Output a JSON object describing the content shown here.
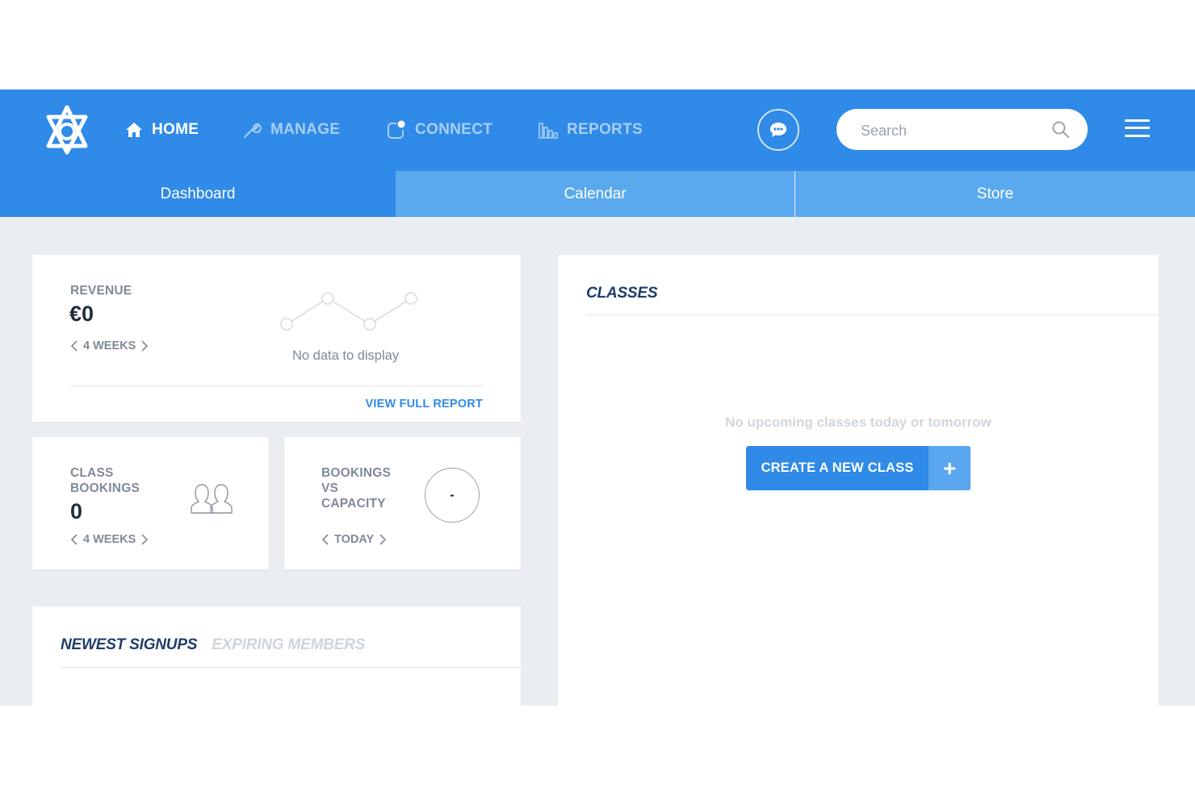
{
  "header": {
    "nav": [
      {
        "label": "HOME",
        "icon": "home-icon"
      },
      {
        "label": "MANAGE",
        "icon": "wrench-icon"
      },
      {
        "label": "CONNECT",
        "icon": "connect-icon"
      },
      {
        "label": "REPORTS",
        "icon": "bar-chart-icon"
      }
    ],
    "search_placeholder": "Search"
  },
  "subtabs": [
    {
      "label": "Dashboard",
      "active": true
    },
    {
      "label": "Calendar",
      "active": false
    },
    {
      "label": "Store",
      "active": false
    }
  ],
  "revenue": {
    "label": "REVENUE",
    "value": "€0",
    "period": "4 WEEKS",
    "empty_text": "No data to display",
    "link": "VIEW FULL REPORT"
  },
  "class_bookings": {
    "label_line1": "CLASS",
    "label_line2": "BOOKINGS",
    "value": "0",
    "period": "4 WEEKS",
    "icon": "people-icon"
  },
  "bookings_capacity": {
    "label_line1": "BOOKINGS",
    "label_line2": "VS",
    "label_line3": "CAPACITY",
    "gauge_value": "-",
    "period": "TODAY"
  },
  "members": {
    "tab_active": "NEWEST SIGNUPS",
    "tab_inactive": "EXPIRING MEMBERS"
  },
  "classes": {
    "title": "CLASSES",
    "empty_text": "No upcoming classes today or tomorrow",
    "create_button": "CREATE A NEW CLASS",
    "create_plus": "+"
  },
  "colors": {
    "primary": "#2f8ae8",
    "tab_inactive": "#5aa9ee",
    "background": "#eaedf1",
    "title_navy": "#1f3d6b"
  }
}
